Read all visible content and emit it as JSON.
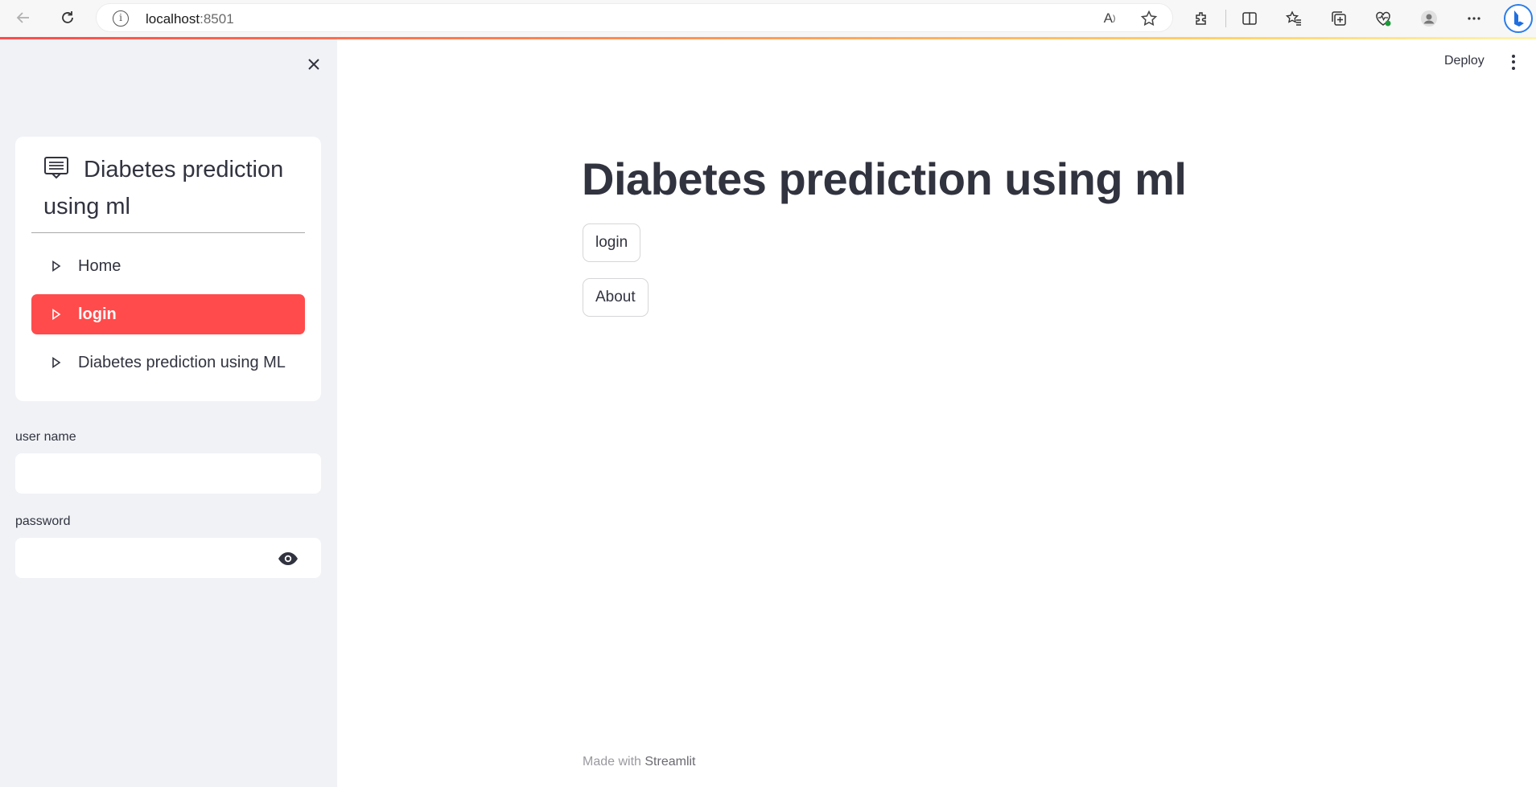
{
  "browser": {
    "url_host": "localhost",
    "url_port": ":8501"
  },
  "sidebar": {
    "menu_title": "Diabetes prediction using ml",
    "items": [
      {
        "label": "Home",
        "active": false
      },
      {
        "label": "login",
        "active": true
      },
      {
        "label": "Diabetes prediction using ML",
        "active": false
      }
    ],
    "username_label": "user name",
    "username_value": "",
    "password_label": "password",
    "password_value": ""
  },
  "header": {
    "deploy_label": "Deploy"
  },
  "main": {
    "title": "Diabetes prediction using ml",
    "buttons": [
      "login",
      "About"
    ]
  },
  "footer": {
    "made_with": "Made with",
    "brand": "Streamlit"
  },
  "colors": {
    "accent": "#ff4b4b",
    "sidebar_bg": "#f0f2f6",
    "text": "#31333f"
  }
}
